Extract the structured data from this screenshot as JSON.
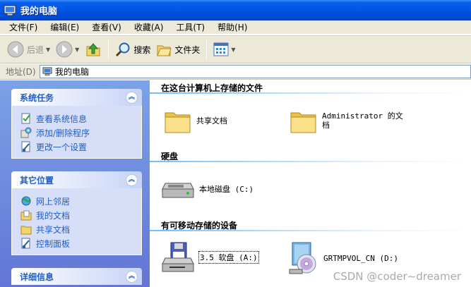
{
  "window": {
    "title": "我的电脑"
  },
  "menu": [
    "文件(F)",
    "编辑(E)",
    "查看(V)",
    "收藏(A)",
    "工具(T)",
    "帮助(H)"
  ],
  "toolbar": {
    "back": "后退",
    "search": "搜索",
    "folders": "文件夹"
  },
  "address": {
    "label": "地址(D)",
    "value": "我的电脑"
  },
  "sidebar": {
    "system_tasks": {
      "title": "系统任务",
      "items": [
        "查看系统信息",
        "添加/删除程序",
        "更改一个设置"
      ]
    },
    "other_places": {
      "title": "其它位置",
      "items": [
        "网上邻居",
        "我的文档",
        "共享文档",
        "控制面板"
      ]
    },
    "details": {
      "title": "详细信息"
    }
  },
  "groups": {
    "stored_files": {
      "title": "在这台计算机上存储的文件",
      "items": [
        "共享文档",
        "Administrator 的文档"
      ]
    },
    "hard_disks": {
      "title": "硬盘",
      "items": [
        "本地磁盘 (C:)"
      ]
    },
    "removable": {
      "title": "有可移动存储的设备",
      "items": [
        "3.5 软盘 (A:)",
        "GRTMPVOL_CN (D:)"
      ]
    }
  },
  "watermark": "CSDN @coder~dreamer",
  "colors": {
    "title_bar": "#0055e5",
    "sidebar_bg": "#7ba2e7",
    "link": "#215dc6",
    "panel_body": "#d6dff7"
  }
}
